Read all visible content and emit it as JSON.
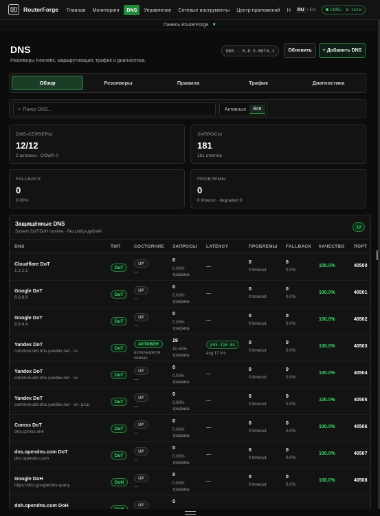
{
  "nav": {
    "brand": "RouterForge",
    "items": [
      "Главная",
      "Мониторинг",
      "DNS",
      "Управление",
      "Сетевые инструменты",
      "Центр приложений",
      "Н"
    ],
    "active_index": 2,
    "lang_ru": "RU",
    "lang_sep": "/",
    "lang_en": "EN",
    "core_status": "CORE: В сети"
  },
  "panel": {
    "label": "Панель RouterForge"
  },
  "header": {
    "title": "DNS",
    "subtitle": "Резолверы Keenetic, маршрутизация, трафик и диагностика.",
    "version": "DNS · 0.8.5-BETA.1",
    "refresh_label": "Обновить",
    "add_label": "+ Добавить DNS"
  },
  "tabs": [
    "Обзор",
    "Резолверы",
    "Правила",
    "Трафик",
    "Диагностика"
  ],
  "search": {
    "placeholder": "Поиск DNS...",
    "filter_active": "Активные",
    "filter_all": "Все"
  },
  "stats": {
    "servers": {
      "label": "DNS-СЕРВЕРЫ",
      "value": "12/12",
      "sub": "2 активны · DOWN 0"
    },
    "requests": {
      "label": "ЗАПРОСЫ",
      "value": "181",
      "sub": "181 ответов"
    },
    "fallback": {
      "label": "FALLBACK",
      "value": "0",
      "sub": "0.00%"
    },
    "problems": {
      "label": "ПРОБЛЕМЫ",
      "value": "0",
      "sub": "0 timeout · degraded 0"
    }
  },
  "protected": {
    "title": "Защищённые DNS",
    "subtitle": "System DoT/DoH runtime · без policy-дублей",
    "count": "12",
    "headers": [
      "DNS",
      "ТИП",
      "СОСТОЯНИЕ",
      "ЗАПРОСЫ",
      "LATENCY",
      "ПРОБЛЕМЫ",
      "FALLBACK",
      "КАЧЕСТВО",
      "ПОРТ"
    ],
    "rows": [
      {
        "name": "Cloudflare DoT",
        "addr": "1.1.1.1",
        "type": "DoT",
        "state": "UP",
        "state_sub": "—",
        "req": "0",
        "pct": "0.00%",
        "traffic": "трафика",
        "latency": "—",
        "prob": "0",
        "prob_sub": "0 timeout",
        "fb": "0",
        "fb_sub": "0.0%",
        "quality": "100.0%",
        "port": "40500"
      },
      {
        "name": "Google DoT",
        "addr": "8.8.8.8",
        "type": "DoT",
        "state": "UP",
        "state_sub": "—",
        "req": "0",
        "pct": "0.00%",
        "traffic": "трафика",
        "latency": "—",
        "prob": "0",
        "prob_sub": "0 timeout",
        "fb": "0",
        "fb_sub": "0.0%",
        "quality": "100.0%",
        "port": "40501"
      },
      {
        "name": "Google DoT",
        "addr": "8.8.4.4",
        "type": "DoT",
        "state": "UP",
        "state_sub": "—",
        "req": "0",
        "pct": "0.00%",
        "traffic": "трафика",
        "latency": "—",
        "prob": "0",
        "prob_sub": "0 timeout",
        "fb": "0",
        "fb_sub": "0.0%",
        "quality": "100.0%",
        "port": "40502"
      },
      {
        "name": "Yandex DoT",
        "addr": "common.dot.dns.yandex.net · ru",
        "type": "DoT",
        "state": "АКТИВЕН",
        "state_sub": "используется\nсейчас",
        "req": "19",
        "pct": "10.50%",
        "traffic": "трафика",
        "latency": "p95 116 ms",
        "latency_sub": "avg 17 ms",
        "prob": "0",
        "prob_sub": "0 timeout",
        "fb": "0",
        "fb_sub": "0.0%",
        "quality": "100.0%",
        "port": "40503"
      },
      {
        "name": "Yandex DoT",
        "addr": "common.dot.dns.yandex.net · su",
        "type": "DoT",
        "state": "UP",
        "state_sub": "—",
        "req": "0",
        "pct": "0.00%",
        "traffic": "трафика",
        "latency": "—",
        "prob": "0",
        "prob_sub": "0 timeout",
        "fb": "0",
        "fb_sub": "0.0%",
        "quality": "100.0%",
        "port": "40504"
      },
      {
        "name": "Yandex DoT",
        "addr": "common.dot.dns.yandex.net · xn--p1ai",
        "type": "DoT",
        "state": "UP",
        "state_sub": "—",
        "req": "0",
        "pct": "0.00%",
        "traffic": "трафика",
        "latency": "—",
        "prob": "0",
        "prob_sub": "0 timeout",
        "fb": "0",
        "fb_sub": "0.0%",
        "quality": "100.0%",
        "port": "40505"
      },
      {
        "name": "Comss DoT",
        "addr": "dns.comss.one",
        "type": "DoT",
        "state": "UP",
        "state_sub": "—",
        "req": "0",
        "pct": "0.00%",
        "traffic": "трафика",
        "latency": "—",
        "prob": "0",
        "prob_sub": "0 timeout",
        "fb": "0",
        "fb_sub": "0.0%",
        "quality": "100.0%",
        "port": "40506"
      },
      {
        "name": "dns.opendns.com DoT",
        "addr": "dns.opendns.com",
        "type": "DoT",
        "state": "UP",
        "state_sub": "—",
        "req": "0",
        "pct": "0.00%",
        "traffic": "трафика",
        "latency": "—",
        "prob": "0",
        "prob_sub": "0 timeout",
        "fb": "0",
        "fb_sub": "0.0%",
        "quality": "100.0%",
        "port": "40507"
      },
      {
        "name": "Google DoH",
        "addr": "https://dns.google/dns-query",
        "type": "DoH",
        "state": "UP",
        "state_sub": "—",
        "req": "0",
        "pct": "0.00%",
        "traffic": "трафика",
        "latency": "—",
        "prob": "0",
        "prob_sub": "0 timeout",
        "fb": "0",
        "fb_sub": "0.0%",
        "quality": "100.0%",
        "port": "40508"
      },
      {
        "name": "doh.opendns.com DoH",
        "addr": "",
        "type": "DoH",
        "state": "UP",
        "state_sub": "",
        "req": "0",
        "pct": "",
        "traffic": "",
        "latency": "",
        "prob": "",
        "prob_sub": "",
        "fb": "",
        "fb_sub": "",
        "quality": "",
        "port": ""
      }
    ]
  }
}
